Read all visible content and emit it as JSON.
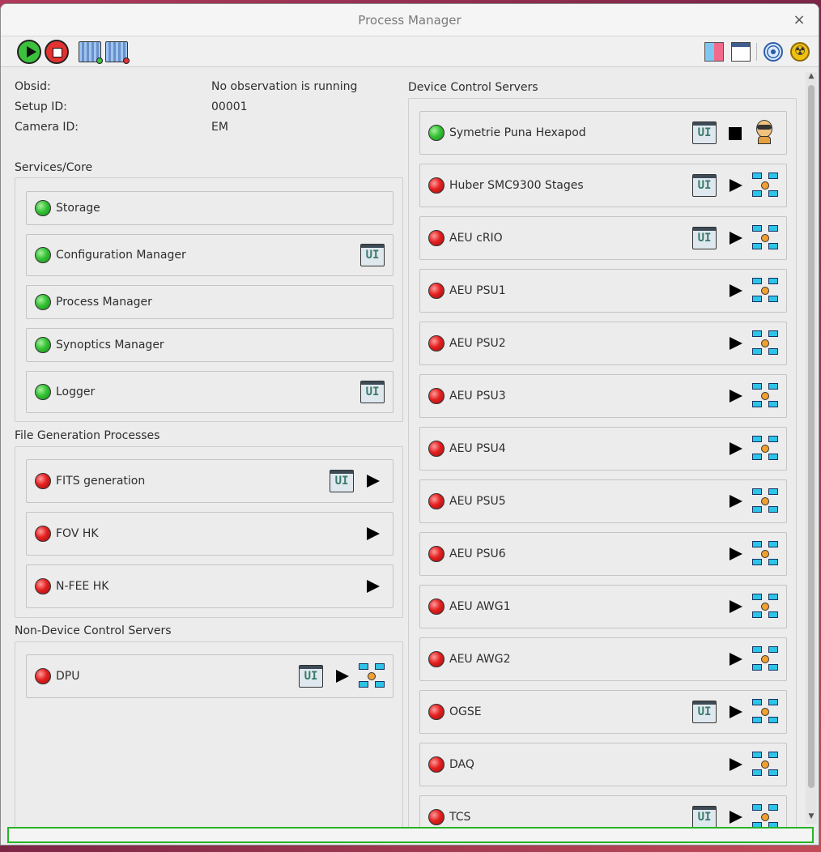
{
  "window": {
    "title": "Process Manager",
    "close_symbol": "×"
  },
  "toolbar": {
    "left": [
      "play-icon",
      "stop-icon",
      "panel-start-icon",
      "panel-stop-icon"
    ],
    "right": [
      "map-icon",
      "dashboard-icon",
      "target-icon",
      "radiation-icon"
    ]
  },
  "info": {
    "obsid_label": "Obsid:",
    "obsid_value": "No observation is running",
    "setup_label": "Setup ID:",
    "setup_value": "00001",
    "camera_label": "Camera ID:",
    "camera_value": "EM"
  },
  "groups": {
    "core": {
      "title": "Services/Core",
      "items": [
        {
          "label": "Storage",
          "status": "green",
          "ui": false
        },
        {
          "label": "Configuration Manager",
          "status": "green",
          "ui": true
        },
        {
          "label": "Process Manager",
          "status": "green",
          "ui": false
        },
        {
          "label": "Synoptics Manager",
          "status": "green",
          "ui": false
        },
        {
          "label": "Logger",
          "status": "green",
          "ui": true
        }
      ]
    },
    "fgp": {
      "title": "File Generation Processes",
      "items": [
        {
          "label": "FITS generation",
          "status": "red",
          "ui": true,
          "play": true
        },
        {
          "label": "FOV HK",
          "status": "red",
          "ui": false,
          "play": true
        },
        {
          "label": "N-FEE HK",
          "status": "red",
          "ui": false,
          "play": true
        }
      ]
    },
    "ndcs": {
      "title": "Non-Device Control Servers",
      "items": [
        {
          "label": "DPU",
          "status": "red",
          "ui": true,
          "play": true,
          "net": true
        }
      ]
    },
    "dcs": {
      "title": "Device Control Servers",
      "items": [
        {
          "label": "Symetrie Puna Hexapod",
          "status": "green",
          "ui": true,
          "action": "stop",
          "icon": "operator"
        },
        {
          "label": "Huber SMC9300 Stages",
          "status": "red",
          "ui": true,
          "action": "play",
          "icon": "network"
        },
        {
          "label": "AEU cRIO",
          "status": "red",
          "ui": true,
          "action": "play",
          "icon": "network"
        },
        {
          "label": "AEU PSU1",
          "status": "red",
          "ui": false,
          "action": "play",
          "icon": "network"
        },
        {
          "label": "AEU PSU2",
          "status": "red",
          "ui": false,
          "action": "play",
          "icon": "network"
        },
        {
          "label": "AEU PSU3",
          "status": "red",
          "ui": false,
          "action": "play",
          "icon": "network"
        },
        {
          "label": "AEU PSU4",
          "status": "red",
          "ui": false,
          "action": "play",
          "icon": "network"
        },
        {
          "label": "AEU PSU5",
          "status": "red",
          "ui": false,
          "action": "play",
          "icon": "network"
        },
        {
          "label": "AEU PSU6",
          "status": "red",
          "ui": false,
          "action": "play",
          "icon": "network"
        },
        {
          "label": "AEU AWG1",
          "status": "red",
          "ui": false,
          "action": "play",
          "icon": "network"
        },
        {
          "label": "AEU AWG2",
          "status": "red",
          "ui": false,
          "action": "play",
          "icon": "network"
        },
        {
          "label": "OGSE",
          "status": "red",
          "ui": true,
          "action": "play",
          "icon": "network"
        },
        {
          "label": "DAQ",
          "status": "red",
          "ui": false,
          "action": "play",
          "icon": "network"
        },
        {
          "label": "TCS",
          "status": "red",
          "ui": true,
          "action": "play",
          "icon": "network"
        }
      ]
    }
  },
  "ui_button_text": "UI",
  "colors": {
    "status_green": "#34c234",
    "status_red": "#e42020",
    "statusbar_border": "#27b427"
  }
}
